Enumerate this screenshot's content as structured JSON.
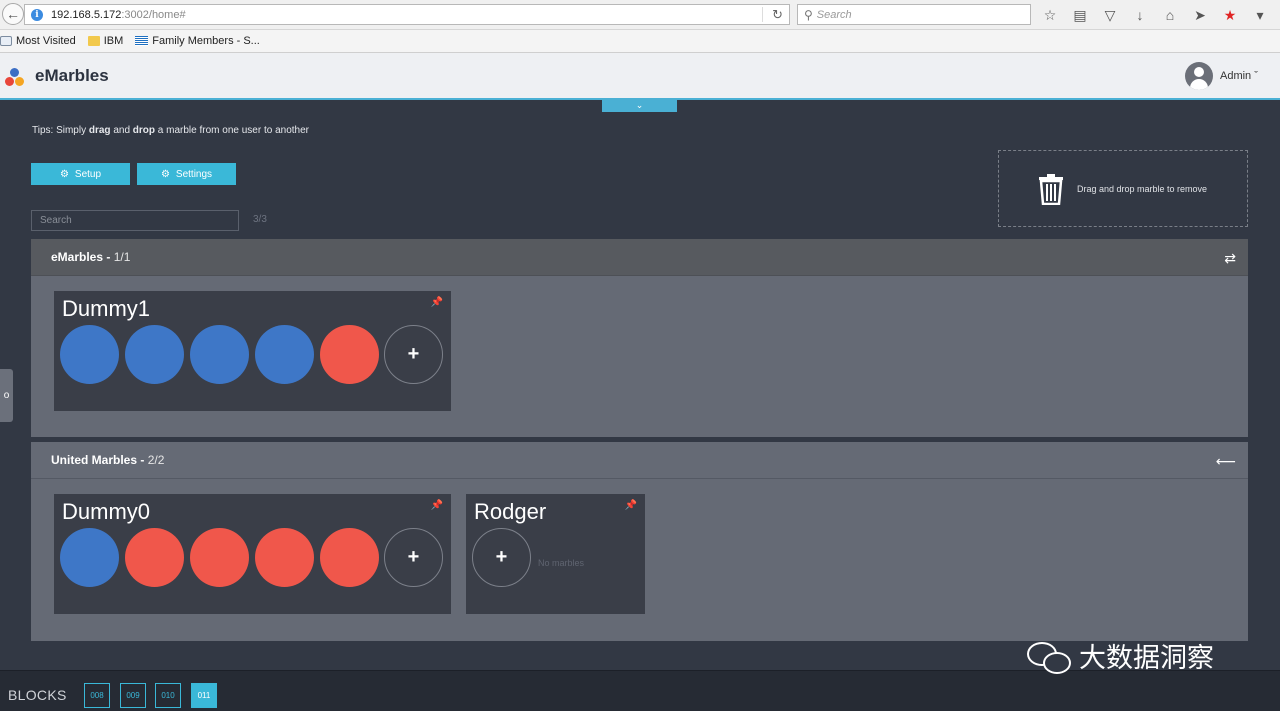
{
  "browser": {
    "url_host": "192.168.5.172",
    "url_path": ":3002/home#",
    "search_placeholder": "Search",
    "bookmarks": [
      {
        "label": "Most Visited",
        "icon": "page-icon"
      },
      {
        "label": "IBM",
        "icon": "folder-icon"
      },
      {
        "label": "Family Members - S...",
        "icon": "ibm-logo-icon"
      }
    ]
  },
  "app": {
    "title": "eMarbles",
    "user": "Admin",
    "logo_colors": [
      "#3b6ec4",
      "#e8463a",
      "#f5a623"
    ]
  },
  "tips": {
    "prefix": "Tips: Simply ",
    "drag": "drag",
    "and": " and ",
    "drop": "drop",
    "suffix": " a marble from one user to another"
  },
  "buttons": {
    "setup": "Setup",
    "settings": "Settings"
  },
  "search": {
    "placeholder": "Search",
    "count": "3/3"
  },
  "trash": {
    "label": "Drag and drop marble to remove"
  },
  "colors": {
    "blue": "#3e77c7",
    "red": "#f0574b",
    "accent": "#3ab8d8"
  },
  "companies": [
    {
      "name": "eMarbles",
      "separator": " - ",
      "count": "1/1",
      "users": [
        {
          "name": "Dummy1",
          "marbles": [
            "blue",
            "blue",
            "blue",
            "blue",
            "red"
          ]
        }
      ]
    },
    {
      "name": "United Marbles",
      "separator": " - ",
      "count": "2/2",
      "users": [
        {
          "name": "Dummy0",
          "marbles": [
            "blue",
            "red",
            "red",
            "red",
            "red"
          ]
        },
        {
          "name": "Rodger",
          "marbles": [],
          "empty_text": "No marbles"
        }
      ]
    }
  ],
  "blocks": {
    "label": "BLOCKS",
    "items": [
      "008",
      "009",
      "010",
      "011"
    ],
    "active": "011"
  },
  "watermark": {
    "text": "大数据洞察"
  }
}
